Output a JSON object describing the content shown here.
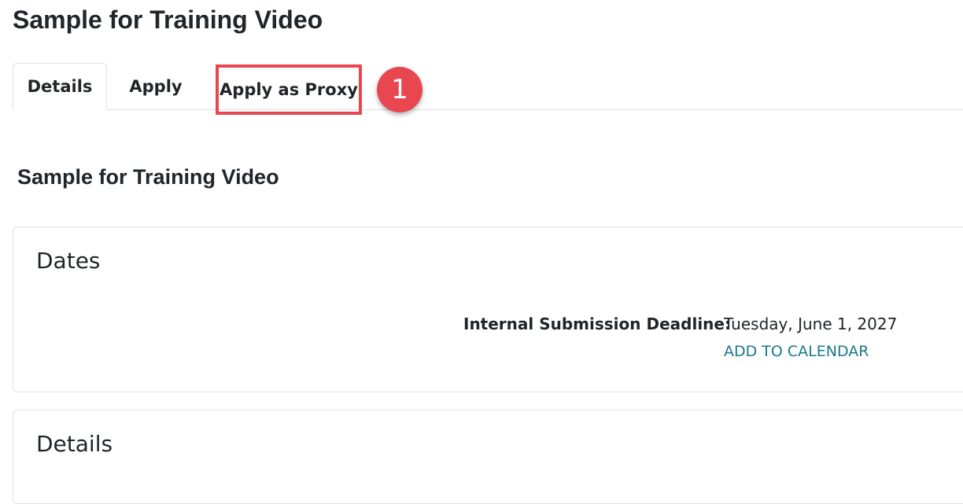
{
  "page": {
    "title": "Sample for Training Video"
  },
  "tabs": [
    {
      "label": "Details"
    },
    {
      "label": "Apply"
    },
    {
      "label": "Apply as Proxy"
    }
  ],
  "callout": {
    "number": "1",
    "color": "#e8474f"
  },
  "content": {
    "subtitle": "Sample for Training Video",
    "dates": {
      "heading": "Dates",
      "deadline_label": "Internal Submission Deadline:",
      "deadline_value": "Tuesday, June 1, 2027",
      "calendar_link": "ADD TO CALENDAR"
    },
    "details": {
      "heading": "Details"
    }
  },
  "colors": {
    "link": "#1a7a8a",
    "highlight": "#e8474f"
  }
}
